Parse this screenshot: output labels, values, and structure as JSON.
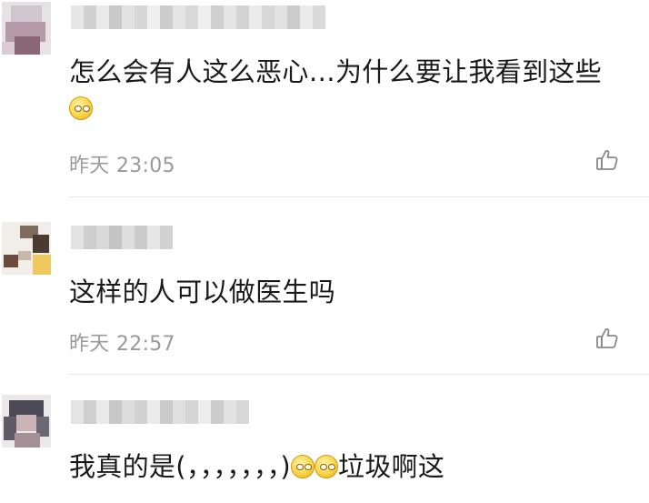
{
  "comments": [
    {
      "text": "怎么会有人这么恶心…为什么要让我看到这些",
      "time": "昨天 23:05",
      "emoji_icons": [
        "pleading-face-emoji-icon"
      ]
    },
    {
      "text": "这样的人可以做医生吗",
      "time": "昨天 22:57",
      "emoji_icons": []
    },
    {
      "text_before": "我真的是(，，，，，，，)",
      "text_after": "垃圾啊这",
      "time": "",
      "emoji_icons": [
        "squinting-face-emoji-icon",
        "squinting-face-emoji-icon"
      ]
    }
  ],
  "icons": {
    "like": "thumbs-up-icon",
    "avatar": "blurred-avatar",
    "username": "blurred-username"
  },
  "colors": {
    "text": "#1a1a1a",
    "time": "#9a9a9a",
    "divider": "#e6e6e6",
    "icon": "#8a8a8a"
  }
}
